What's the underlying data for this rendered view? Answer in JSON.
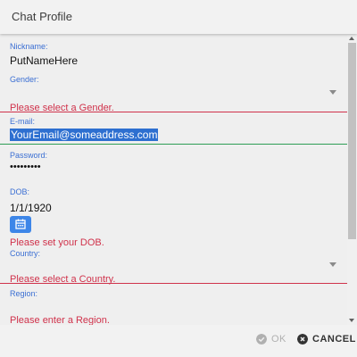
{
  "header": {
    "title": "Chat Profile"
  },
  "form": {
    "nickname": {
      "label": "Nickname:",
      "value": "PutNameHere"
    },
    "gender": {
      "label": "Gender:",
      "value": "",
      "error": "Please select a Gender."
    },
    "email": {
      "label": "E-mail:",
      "value": "YourEmail@someaddress.com"
    },
    "password": {
      "label": "Password:",
      "value": "•••••••••"
    },
    "dob": {
      "label": "DOB:",
      "value": "1/1/1920",
      "error": "Please set your DOB."
    },
    "country": {
      "label": "Country:",
      "value": "",
      "error": "Please select a Country."
    },
    "region": {
      "label": "Region:",
      "value": "",
      "error": "Please enter a Region."
    }
  },
  "footer": {
    "ok_label": "OK",
    "cancel_label": "CANCEL"
  },
  "colors": {
    "label_blue": "#3b6fd3",
    "error_red": "#d0324b",
    "focus_green": "#2e9e55",
    "selection_blue": "#2d6fd0",
    "calendar_button": "#3d86e8"
  }
}
